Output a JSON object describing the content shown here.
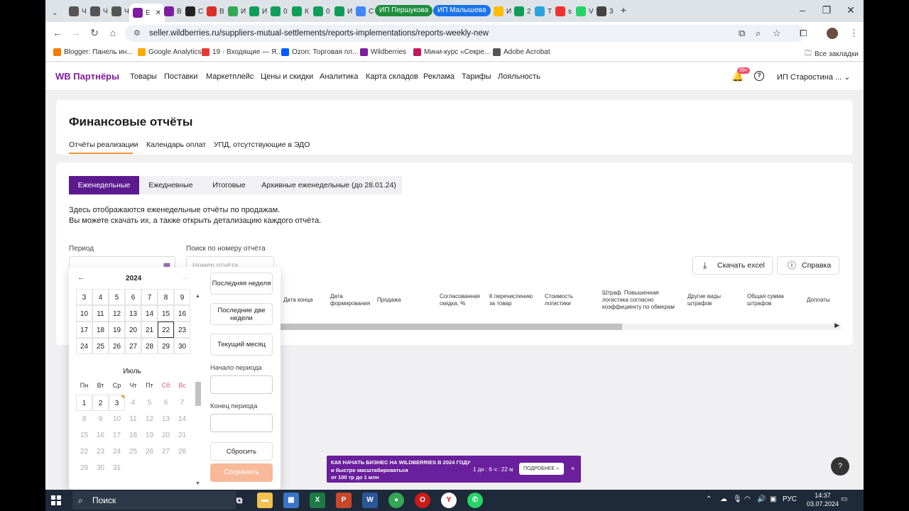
{
  "browser": {
    "tabs": [
      {
        "label": "Ч",
        "color": "#555"
      },
      {
        "label": "Ч",
        "color": "#555"
      },
      {
        "label": "Ч",
        "color": "#555"
      },
      {
        "label": "Е",
        "color": "#7e1d9e",
        "active": true
      },
      {
        "label": "В",
        "color": "#7e1d9e"
      },
      {
        "label": "С",
        "color": "#222"
      },
      {
        "label": "В",
        "color": "#d93025"
      },
      {
        "label": "И",
        "color": "#34a853"
      },
      {
        "label": "И",
        "color": "#0f9d58"
      },
      {
        "label": "0",
        "color": "#0f9d58"
      },
      {
        "label": "К",
        "color": "#0f9d58"
      },
      {
        "label": "0",
        "color": "#0f9d58"
      },
      {
        "label": "И",
        "color": "#0f9d58"
      },
      {
        "label": "С",
        "color": "#4285f4"
      }
    ],
    "groups": [
      {
        "label": "ИП Першукова",
        "color": "#1e8e3e"
      },
      {
        "label": "ИП Малышева",
        "color": "#1a73e8"
      }
    ],
    "tabs2": [
      {
        "label": "И",
        "color": "#fbbc04"
      },
      {
        "label": "2",
        "color": "#0f9d58"
      },
      {
        "label": "Т",
        "color": "#2aa3df"
      },
      {
        "label": "s",
        "color": "#e33"
      },
      {
        "label": "V",
        "color": "#25d366"
      },
      {
        "label": "3",
        "color": "#444"
      }
    ],
    "new_tab": "+",
    "url": "seller.wildberries.ru/suppliers-mutual-settlements/reports-implementations/reports-weekly-new",
    "bookmarks": [
      {
        "label": "Blogger: Панель ин...",
        "color": "#f57c00"
      },
      {
        "label": "Google Analytics",
        "color": "#f9ab00"
      },
      {
        "label": "19 · Входящие — Я...",
        "color": "#e53935"
      },
      {
        "label": "Ozon: Торговая пл...",
        "color": "#005bff"
      },
      {
        "label": "Wildberries",
        "color": "#7e1d9e"
      },
      {
        "label": "Мини-курс «Секре...",
        "color": "#c2185b"
      },
      {
        "label": "Adobe Acrobat",
        "color": "#555"
      }
    ],
    "all_bookmarks": "Все закладки"
  },
  "site": {
    "logo": "WB Партнёры",
    "nav": [
      "Товары",
      "Поставки",
      "Маркетплейс",
      "Цены и скидки",
      "Аналитика",
      "Карта складов",
      "Реклама",
      "Тарифы",
      "Лояльность"
    ],
    "notification_badge": "99+",
    "user": "ИП Старостина ..."
  },
  "page": {
    "title": "Финансовые отчёты",
    "subtabs": [
      "Отчёты реализации",
      "Календарь оплат",
      "УПД, отсутствующие в ЭДО"
    ],
    "segments": [
      "Еженедельные",
      "Ежедневные",
      "Итоговые",
      "Архивные еженедельные (до 28.01.24)"
    ],
    "desc1": "Здесь отображаются еженедельные отчёты по продажам.",
    "desc2": "Вы можете скачать их, а также открыть детализацию каждого отчёта.",
    "period_label": "Период",
    "search_label": "Поиск по номеру отчёта",
    "search_placeholder": "Номер отчёта",
    "excel_button": "Скачать excel",
    "help_button": "Справка",
    "columns": [
      "Дата конца",
      "Дата формирования",
      "Продажа",
      "Согласованная скидка, %",
      "К перечислению за товар",
      "Стоимость логистики",
      "Штраф. Повышенная логистика согласно коэффициенту по обмерам",
      "Другие виды штрафов",
      "Общая сумма штрафов",
      "Доплаты"
    ]
  },
  "calendar": {
    "year": "2024",
    "june_rows": [
      [
        "3",
        "4",
        "5",
        "6",
        "7",
        "8",
        "9"
      ],
      [
        "10",
        "11",
        "12",
        "13",
        "14",
        "15",
        "16"
      ],
      [
        "17",
        "18",
        "19",
        "20",
        "21",
        "22",
        "23"
      ],
      [
        "24",
        "25",
        "26",
        "27",
        "28",
        "29",
        "30"
      ]
    ],
    "selected_day": "22",
    "july_name": "Июль",
    "weekdays": [
      "Пн",
      "Вт",
      "Ср",
      "Чт",
      "Пт",
      "Сб",
      "Вс"
    ],
    "july_rows": [
      [
        "1",
        "2",
        "3",
        "4",
        "5",
        "6",
        "7"
      ],
      [
        "8",
        "9",
        "10",
        "11",
        "12",
        "13",
        "14"
      ],
      [
        "15",
        "16",
        "17",
        "18",
        "19",
        "20",
        "21"
      ],
      [
        "22",
        "23",
        "24",
        "25",
        "26",
        "27",
        "28"
      ],
      [
        "29",
        "30",
        "31",
        "",
        "",
        "",
        ""
      ]
    ],
    "today": "3",
    "quick": [
      "Последняя неделя",
      "Последние две недели",
      "Текущий месяц"
    ],
    "start_label": "Начало периода",
    "end_label": "Конец периода",
    "reset": "Сбросить",
    "save": "Сохранить"
  },
  "promo": {
    "line1": "КАК НАЧАТЬ БИЗНЕС НА WILDBERRIES В 2024 ГОДУ",
    "line2": "и быстро масштабироваться",
    "line3": "от 100 тр до 1 млн",
    "timer": "1 дн : 6 ч : 22 м",
    "more": "ПОДРОБНЕЕ ›› ",
    "close": "×"
  },
  "help_bubble": "?",
  "taskbar": {
    "search": "Поиск",
    "lang": "РУС",
    "time": "14:37",
    "date": "03.07.2024"
  }
}
